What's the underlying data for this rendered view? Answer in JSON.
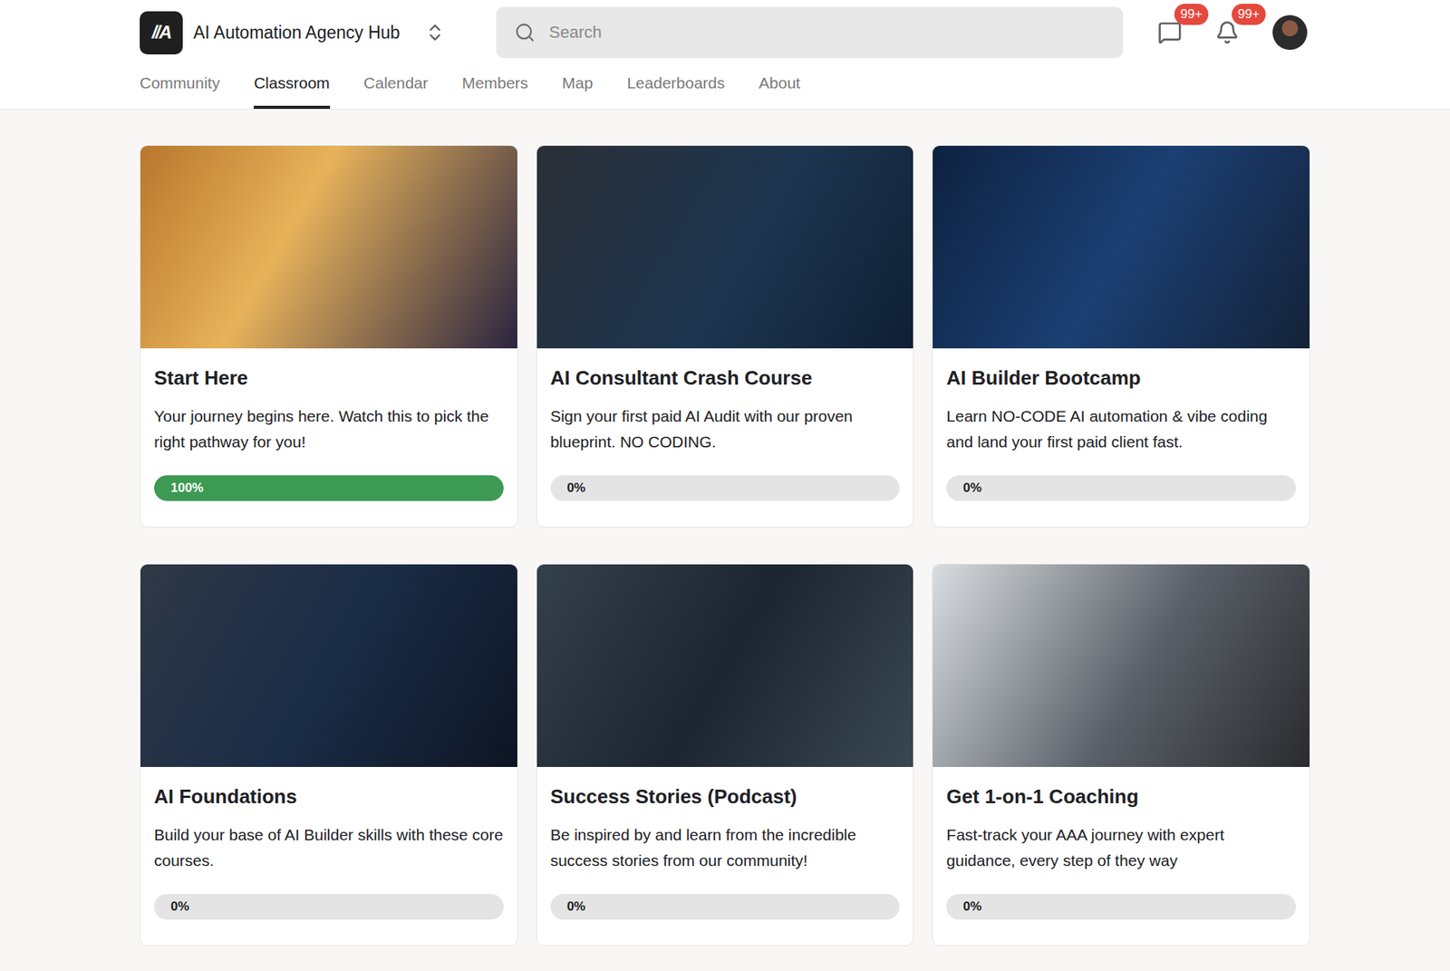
{
  "header": {
    "logo": "//A",
    "title": "AI Automation Agency Hub",
    "search": {
      "placeholder": "Search"
    },
    "chat_badge": "99+",
    "notification_badge": "99+"
  },
  "tabs": [
    {
      "label": "Community",
      "selected": false
    },
    {
      "label": "Classroom",
      "selected": true
    },
    {
      "label": "Calendar",
      "selected": false
    },
    {
      "label": "Members",
      "selected": false
    },
    {
      "label": "Map",
      "selected": false
    },
    {
      "label": "Leaderboards",
      "selected": false
    },
    {
      "label": "About",
      "selected": false
    }
  ],
  "courses": [
    {
      "title": "Start Here",
      "description": "Your journey begins here. Watch this to pick the right pathway for you!",
      "progress": "100%",
      "level": 1
    },
    {
      "title": "AI Consultant Crash Course",
      "description": "Sign your first paid AI Audit with our proven blueprint. NO CODING.",
      "progress": "0%",
      "level": 0
    },
    {
      "title": "AI Builder Bootcamp",
      "description": "Learn NO-CODE AI automation & vibe coding and land your first paid client fast.",
      "progress": "0%",
      "level": 0
    },
    {
      "title": "AI Foundations",
      "description": "Build your base of AI Builder skills with these core courses.",
      "progress": "0%",
      "level": 0
    },
    {
      "title": "Success Stories (Podcast)",
      "description": "Be inspired by and learn from the incredible success stories from our community!",
      "progress": "0%",
      "level": 0
    },
    {
      "title": "Get 1-on-1 Coaching",
      "description": "Fast-track your AAA journey with expert guidance, every step of they way",
      "progress": "0%",
      "level": 0
    }
  ]
}
